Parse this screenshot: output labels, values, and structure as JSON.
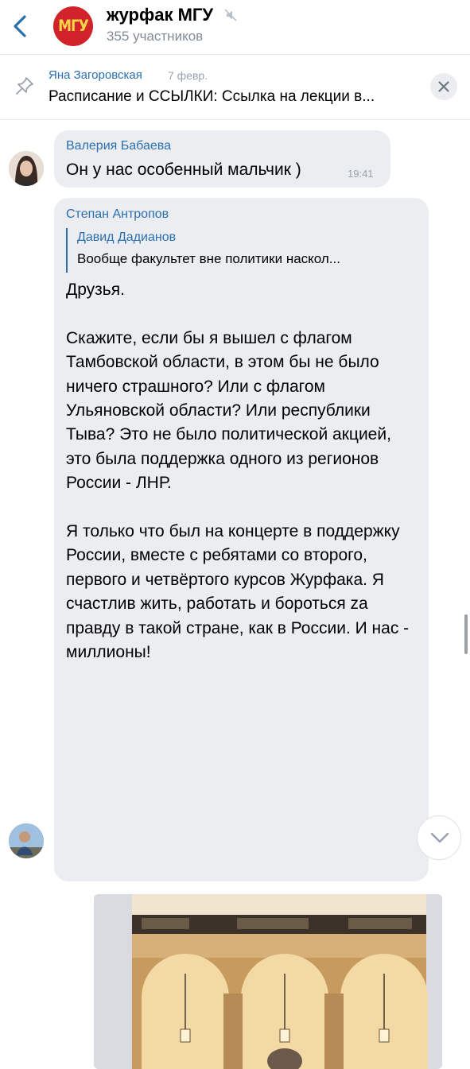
{
  "header": {
    "title": "журфак МГУ",
    "subtitle": "355 участников",
    "avatar_text": "МГУ",
    "back_icon": "chevron-left-icon",
    "mute_icon": "muted-icon"
  },
  "pinned": {
    "author": "Яна Загоровская",
    "date": "7 февр.",
    "text": "Расписание и ССЫЛКИ: Ссылка на лекции в...",
    "pin_icon": "pin-icon",
    "close_icon": "close-icon"
  },
  "messages": [
    {
      "author": "Валерия Бабаева",
      "text": "Он у нас особенный мальчик )",
      "time": "19:41"
    },
    {
      "author": "Степан Антропов",
      "reply": {
        "author": "Давид Дадианов",
        "text": "Вообще факультет вне политики наскол..."
      },
      "paragraphs": [
        "Друзья.",
        "Скажите, если бы я вышел с флагом Тамбовской области, в этом бы не было ничего страшного? Или с флагом Ульяновской области? Или республики Тыва? Это не было политической акцией, это была поддержка одного из регионов России - ЛНР.",
        "Я только что был на концерте в поддержку России, вместе с ребятами со второго, первого и четвёртого курсов Журфака. Я счастлив жить, работать и бороться zа правду в такой стране, как в России. И нас - миллионы!"
      ]
    }
  ],
  "colors": {
    "accent": "#2a6fb0",
    "bubble": "#ebedf0",
    "secondary_text": "#818c99"
  },
  "scroll_down_icon": "chevron-down-icon"
}
